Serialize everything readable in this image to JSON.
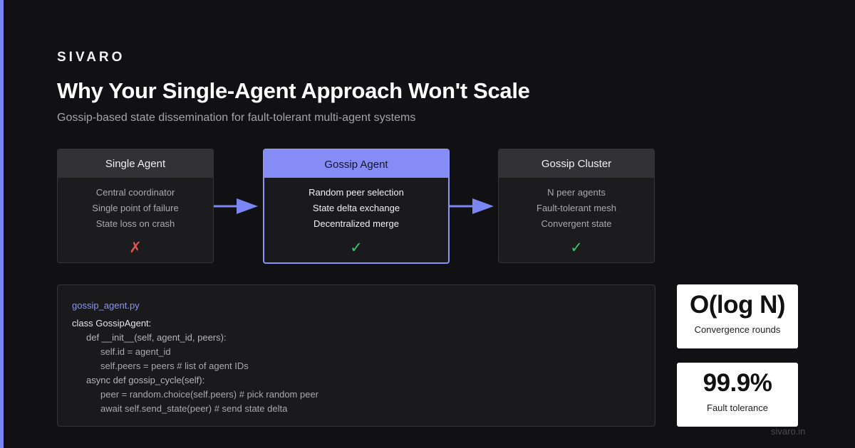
{
  "brand": "SIVARO",
  "title": "Why Your Single-Agent Approach Won't Scale",
  "subtitle": "Gossip-based state dissemination for fault-tolerant multi-agent systems",
  "cards": [
    {
      "title": "Single Agent",
      "lines": [
        "Central coordinator",
        "Single point of failure",
        "State loss on crash"
      ],
      "mark": "✗",
      "status": "fail"
    },
    {
      "title": "Gossip Agent",
      "lines": [
        "Random peer selection",
        "State delta exchange",
        "Decentralized merge"
      ],
      "mark": "✓",
      "status": "ok"
    },
    {
      "title": "Gossip Cluster",
      "lines": [
        "N peer agents",
        "Fault-tolerant mesh",
        "Convergent state"
      ],
      "mark": "✓",
      "status": "ok"
    }
  ],
  "code": {
    "filename": "gossip_agent.py",
    "lines": [
      "class GossipAgent:",
      "def __init__(self, agent_id, peers):",
      "self.id = agent_id",
      "self.peers = peers # list of agent IDs",
      "async def gossip_cycle(self):",
      "peer = random.choice(self.peers) # pick random peer",
      "await self.send_state(peer) # send state delta"
    ]
  },
  "stats": [
    {
      "value": "O(log N)",
      "label": "Convergence rounds"
    },
    {
      "value": "99.9%",
      "label": "Fault tolerance"
    }
  ],
  "footer": "sivaro.in",
  "colors": {
    "accent": "#7b86f2",
    "background": "#111113",
    "fail": "#e05252",
    "ok": "#3ec46d"
  }
}
